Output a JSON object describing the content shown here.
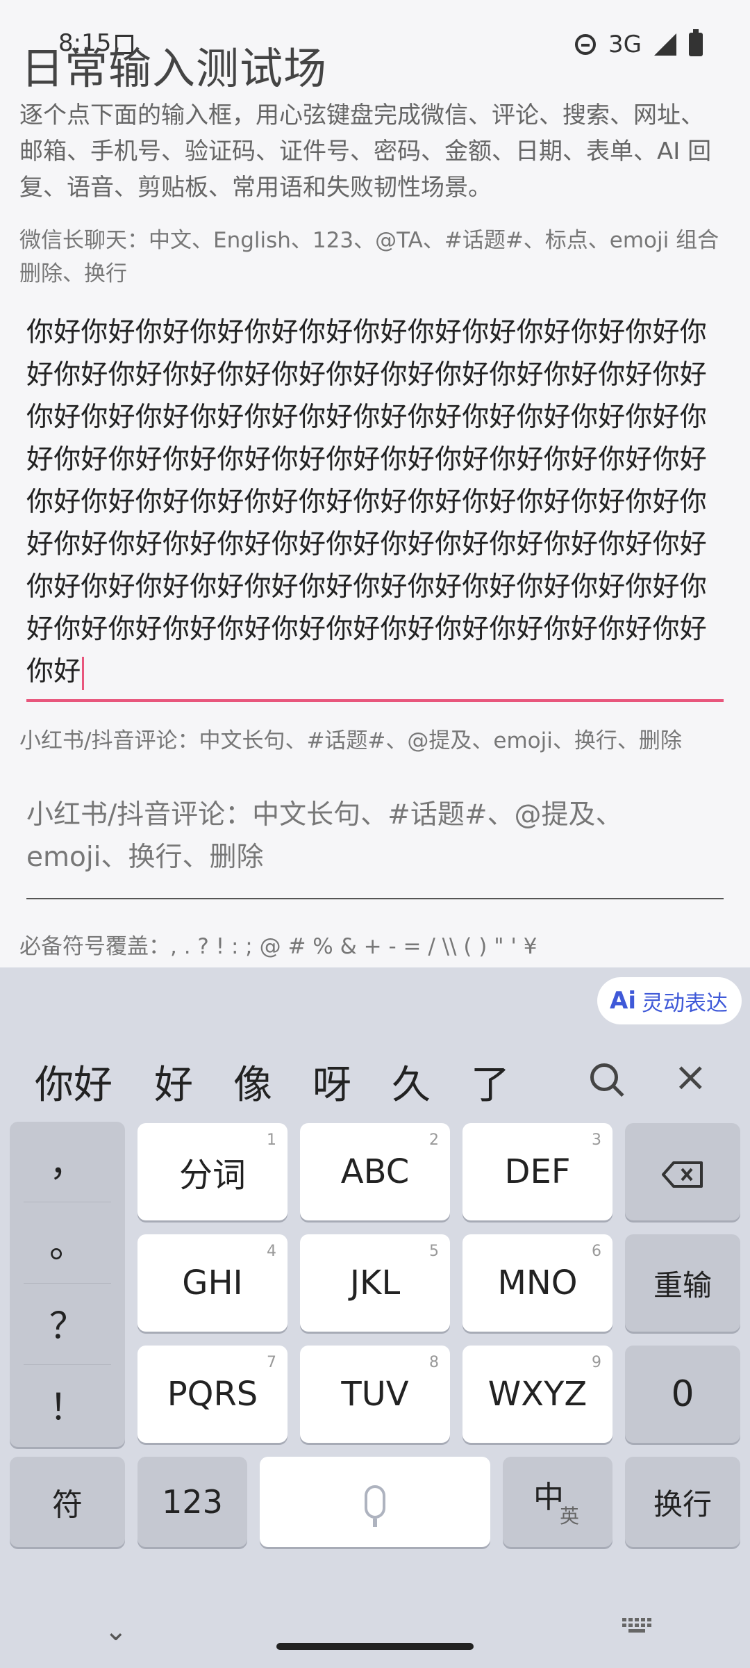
{
  "status": {
    "time": "8:15",
    "network": "3G"
  },
  "page": {
    "title": "日常输入测试场",
    "intro": "逐个点下面的输入框，用心弦键盘完成微信、评论、搜索、网址、邮箱、手机号、验证码、证件号、密码、金额、日期、表单、AI 回复、语音、剪贴板、常用语和失败韧性场景。"
  },
  "fields": [
    {
      "label": "微信长聊天：中文、English、123、@TA、#话题#、标点、emoji 组合删除、换行",
      "value": "你好你好你好你好你好你好你好你好你好你好你好你好你好你好你好你好你好你好你好你好你好你好你好你好你好你好你好你好你好你好你好你好你好你好你好你好你好你好你好你好你好你好你好你好你好你好你好你好你好你好你好你好你好你好你好你好你好你好你好你好你好你好你好你好你好你好你好你好你好你好你好你好你好你好你好你好你好你好你好你好你好你好你好你好你好你好你好你好你好你好你好你好你好你好你好你好你好你好你好你好你好"
    },
    {
      "label": "小红书/抖音评论：中文长句、#话题#、@提及、emoji、换行、删除",
      "placeholder": "小红书/抖音评论：中文长句、#话题#、@提及、emoji、换行、删除"
    },
    {
      "label": "必备符号覆盖：, . ? ! : ; @ # % & + - = / \\\\ ( ) \" ' ¥"
    }
  ],
  "keyboard": {
    "ai_label": "灵动表达",
    "candidates": [
      "你好",
      "好",
      "像",
      "呀",
      "久",
      "了"
    ],
    "punctuation": [
      "，",
      "。",
      "？",
      "！"
    ],
    "keys": {
      "k1": {
        "label": "分词",
        "num": "1"
      },
      "k2": {
        "label": "ABC",
        "num": "2"
      },
      "k3": {
        "label": "DEF",
        "num": "3"
      },
      "k4": {
        "label": "GHI",
        "num": "4"
      },
      "k5": {
        "label": "JKL",
        "num": "5"
      },
      "k6": {
        "label": "MNO",
        "num": "6"
      },
      "k7": {
        "label": "PQRS",
        "num": "7"
      },
      "k8": {
        "label": "TUV",
        "num": "8"
      },
      "k9": {
        "label": "WXYZ",
        "num": "9"
      }
    },
    "reset": "重输",
    "zero": "0",
    "symbols": "符",
    "numbers": "123",
    "lang_main": "中",
    "lang_alt": "英",
    "enter": "换行"
  }
}
